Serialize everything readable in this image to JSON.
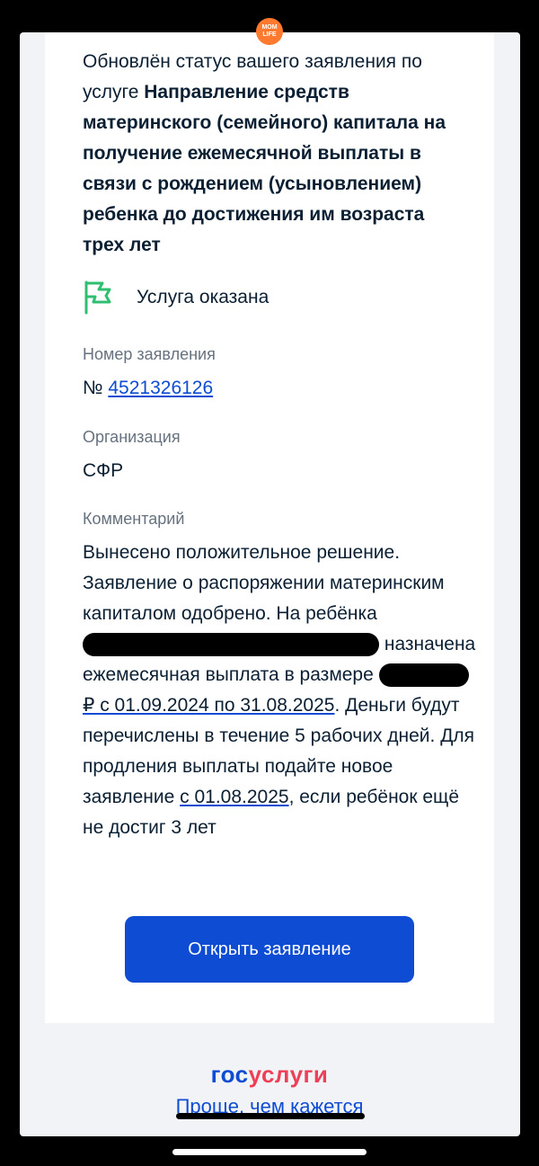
{
  "logo": {
    "line1": "MOM",
    "line2": "LIFE"
  },
  "message": {
    "intro_plain": "Обновлён статус вашего заявления по услуге ",
    "intro_bold": "Направление средств материнского (семейного) капитала на получение ежемесячной выплаты в связи с рождением (усыновлением) ребенка до достижения им возраста трех лет",
    "status_icon": "flag-icon",
    "status_text": "Услуга оказана",
    "application_label": "Номер заявления",
    "application_prefix": "№ ",
    "application_number": "4521326126",
    "organization_label": "Организация",
    "organization_value": "СФР",
    "comment_label": "Комментарий",
    "comment_part1": "Вынесено положительное решение. Заявление о распоряжении материнским капиталом одобрено. На ребёнка",
    "comment_part2": "назначена ежемесячная выплата в размере",
    "comment_part3": "₽ с 01.09.2024 по 31.08.2025",
    "comment_part4": ". Деньги будут перечислены в течение 5 рабочих дней. Для продления выплаты подайте новое заявление ",
    "comment_part5": "с 01.08.2025",
    "comment_part6": ", если ребёнок ещё не достиг 3 лет",
    "open_button": "Открыть заявление"
  },
  "footer": {
    "brand_part1": "гос",
    "brand_part2": "услуги",
    "slogan": "Проще, чем кажется"
  },
  "colors": {
    "accent": "#0d4cd3",
    "brand_red": "#ee3f58",
    "status_green": "#2fbf71"
  }
}
